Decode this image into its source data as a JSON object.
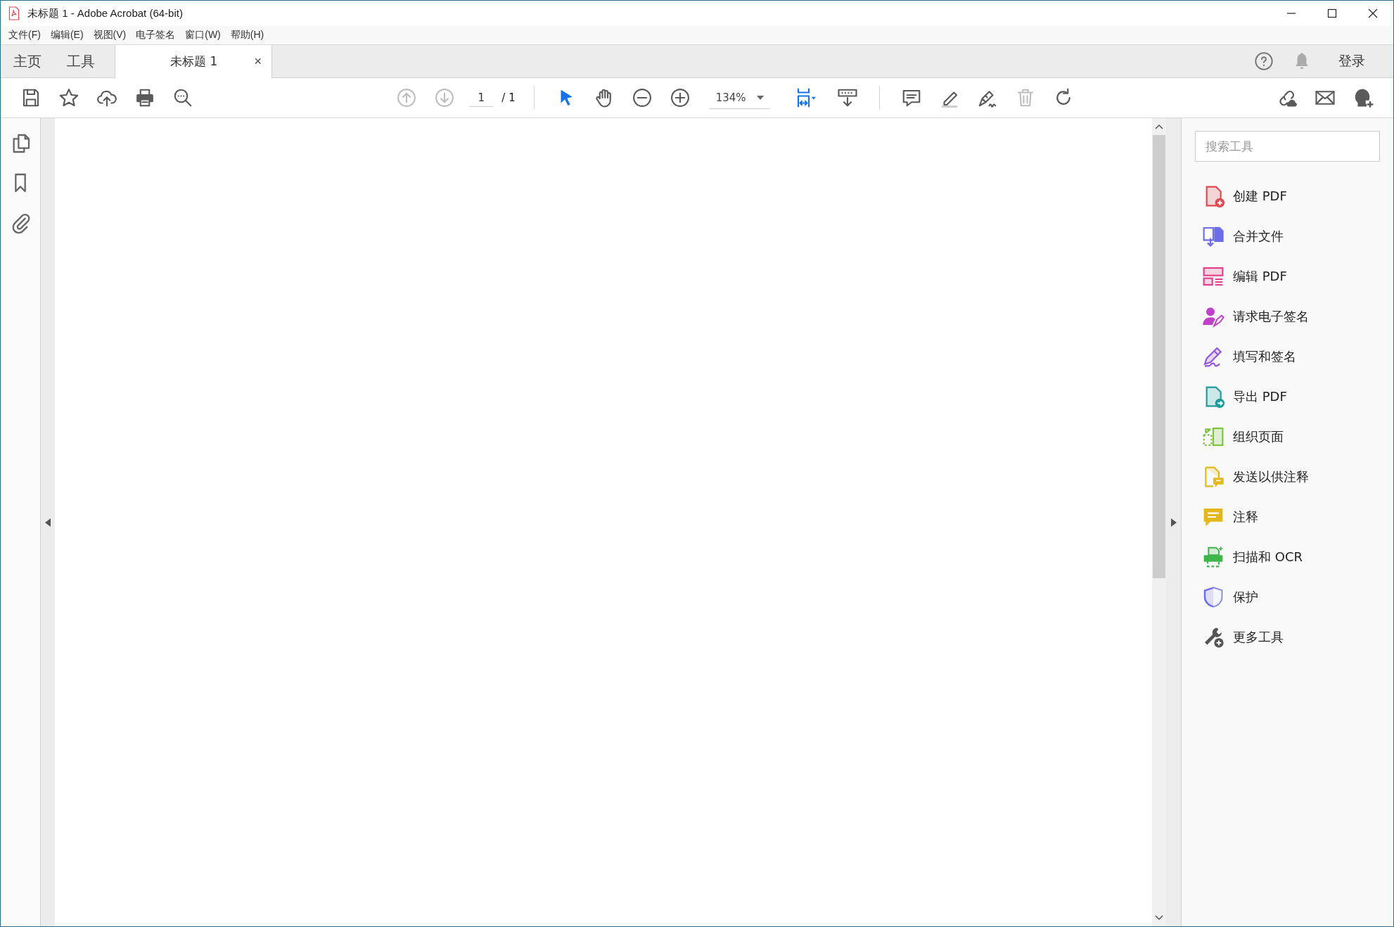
{
  "window": {
    "title": "未标题 1 - Adobe Acrobat (64-bit)"
  },
  "menu": [
    "文件(F)",
    "编辑(E)",
    "视图(V)",
    "电子签名",
    "窗口(W)",
    "帮助(H)"
  ],
  "tabs": [
    {
      "label": "主页",
      "selected": false
    },
    {
      "label": "工具",
      "selected": false
    }
  ],
  "document_tab": {
    "label": "未标题 1",
    "close": "×",
    "selected": true
  },
  "account": {
    "sign_in": "登录"
  },
  "toolbar": [
    {
      "kind": "save",
      "disabled": false,
      "selected": false
    },
    {
      "kind": "star",
      "disabled": false,
      "selected": false
    },
    {
      "kind": "upload",
      "disabled": false,
      "selected": false
    },
    {
      "kind": "print",
      "disabled": false,
      "selected": false
    },
    {
      "kind": "zoom-search",
      "disabled": false,
      "selected": false
    },
    {
      "kind": "prev-page",
      "disabled": true,
      "selected": false
    },
    {
      "kind": "next-page",
      "disabled": true,
      "selected": false
    },
    {
      "kind": "page-field",
      "value": "1",
      "total": "/ 1"
    },
    {
      "kind": "separator"
    },
    {
      "kind": "select",
      "disabled": false,
      "selected": true
    },
    {
      "kind": "hand",
      "disabled": false,
      "selected": false
    },
    {
      "kind": "zoom-out",
      "disabled": false,
      "selected": false
    },
    {
      "kind": "zoom-in",
      "disabled": false,
      "selected": false
    },
    {
      "kind": "zoom-field",
      "value": "134%"
    },
    {
      "kind": "fit",
      "disabled": false
    },
    {
      "kind": "scroll-mode",
      "disabled": false,
      "selected": false
    },
    {
      "kind": "separator"
    },
    {
      "kind": "comment",
      "disabled": false,
      "selected": false
    },
    {
      "kind": "highlight",
      "disabled": false,
      "selected": false
    },
    {
      "kind": "sign",
      "disabled": false,
      "selected": false
    },
    {
      "kind": "delete",
      "disabled": true,
      "selected": false
    },
    {
      "kind": "rotate",
      "disabled": false,
      "selected": false
    },
    {
      "kind": "share-link",
      "disabled": false,
      "selected": false
    },
    {
      "kind": "mail",
      "disabled": false,
      "selected": false
    },
    {
      "kind": "add-user",
      "disabled": false,
      "selected": false
    }
  ],
  "sidebar": [
    {
      "kind": "pages"
    },
    {
      "kind": "bookmark"
    },
    {
      "kind": "attachment"
    }
  ],
  "tools_panel": {
    "search": {
      "placeholder": "搜索工具"
    },
    "tools": [
      {
        "kind": "create",
        "label": "创建 PDF",
        "color": "#e34850"
      },
      {
        "kind": "combine",
        "label": "合并文件",
        "color": "#6d6de8"
      },
      {
        "kind": "edit",
        "label": "编辑 PDF",
        "color": "#e0408a"
      },
      {
        "kind": "request-sign",
        "label": "请求电子签名",
        "color": "#c042c8"
      },
      {
        "kind": "fill-sign",
        "label": "填写和签名",
        "color": "#9155e0"
      },
      {
        "kind": "export",
        "label": "导出 PDF",
        "color": "#1f9a9a"
      },
      {
        "kind": "organize",
        "label": "组织页面",
        "color": "#7cc43f"
      },
      {
        "kind": "send-comment",
        "label": "发送以供注释",
        "color": "#e3b81d"
      },
      {
        "kind": "comment",
        "label": "注释",
        "color": "#e3b81d"
      },
      {
        "kind": "scan",
        "label": "扫描和 OCR",
        "color": "#3db54a"
      },
      {
        "kind": "protect",
        "label": "保护",
        "color": "#6d6de8"
      },
      {
        "kind": "more",
        "label": "更多工具",
        "color": "#555555"
      }
    ]
  }
}
